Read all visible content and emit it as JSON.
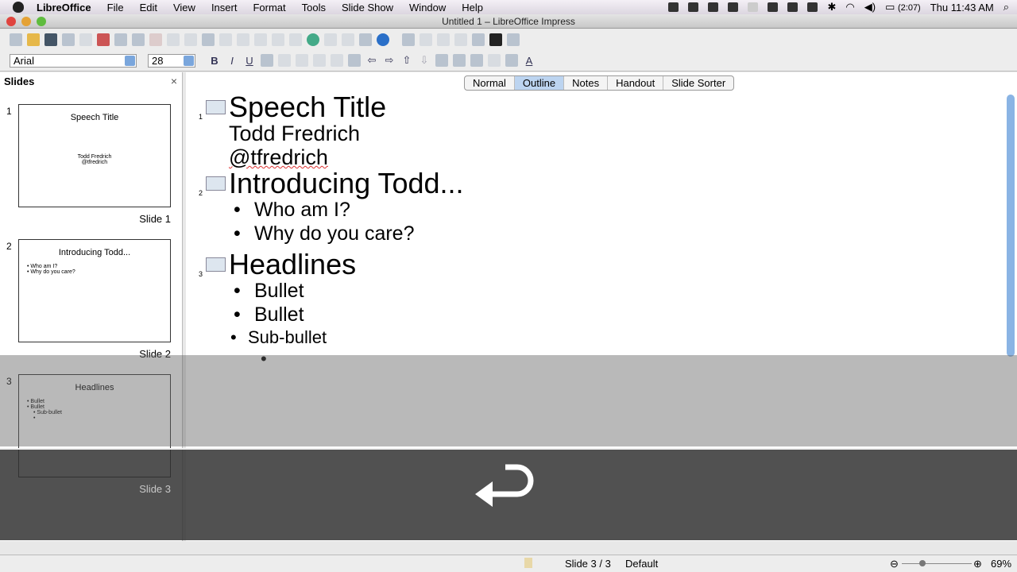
{
  "menubar": {
    "app": "LibreOffice",
    "items": [
      "File",
      "Edit",
      "View",
      "Insert",
      "Format",
      "Tools",
      "Slide Show",
      "Window",
      "Help"
    ],
    "battery": "(2:07)",
    "clock": "Thu 11:43 AM"
  },
  "window": {
    "title": "Untitled 1 – LibreOffice Impress"
  },
  "toolbar": {
    "font": "Arial",
    "size": "28",
    "bold": "B",
    "italic": "I",
    "underline": "U"
  },
  "slides_pane": {
    "title": "Slides",
    "close": "×",
    "slides": [
      {
        "num": "1",
        "label": "Slide 1",
        "title": "Speech Title",
        "lines": [
          "Todd Fredrich",
          "@tfredrich"
        ]
      },
      {
        "num": "2",
        "label": "Slide 2",
        "title": "Introducing Todd...",
        "lines": [
          "• Who am I?",
          "• Why do you care?"
        ]
      },
      {
        "num": "3",
        "label": "Slide 3",
        "title": "Headlines",
        "lines": [
          "• Bullet",
          "• Bullet",
          "• Sub-bullet",
          "•"
        ]
      }
    ]
  },
  "view_tabs": [
    "Normal",
    "Outline",
    "Notes",
    "Handout",
    "Slide Sorter"
  ],
  "active_tab": "Outline",
  "outline": {
    "s1": {
      "num": "1",
      "title": "Speech Title",
      "lines": [
        "Todd Fredrich",
        "@tfredrich"
      ]
    },
    "s2": {
      "num": "2",
      "title": "Introducing Todd...",
      "bullets": [
        "Who am I?",
        "Why do you care?"
      ]
    },
    "s3": {
      "num": "3",
      "title": "Headlines",
      "bullets": [
        "Bullet",
        "Bullet"
      ],
      "sub": [
        "Sub-bullet",
        ""
      ]
    }
  },
  "statusbar": {
    "slide": "Slide 3 / 3",
    "layout": "Default",
    "zoom": "69%"
  },
  "overlay": {
    "icon": "return-arrow-icon"
  }
}
